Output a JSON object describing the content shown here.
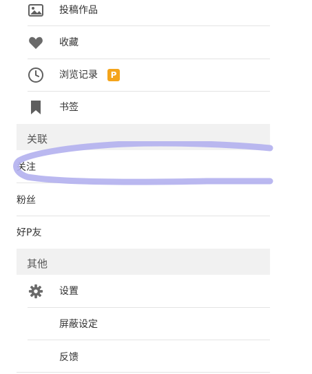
{
  "menu": {
    "submit": "投稿作品",
    "bookmarks": "收藏",
    "history": "浏览记录",
    "history_badge": "P",
    "bookmark_tag": "书签"
  },
  "section_related": {
    "title": "关联",
    "follow": "关注",
    "fans": "粉丝",
    "friends": "好P友"
  },
  "section_other": {
    "title": "其他",
    "settings": "设置",
    "block_settings": "屏蔽设定",
    "feedback": "反馈"
  },
  "colors": {
    "badge": "#f4a41b",
    "section_bg": "#f1f1f1",
    "scribble": "#b3b0ee"
  }
}
